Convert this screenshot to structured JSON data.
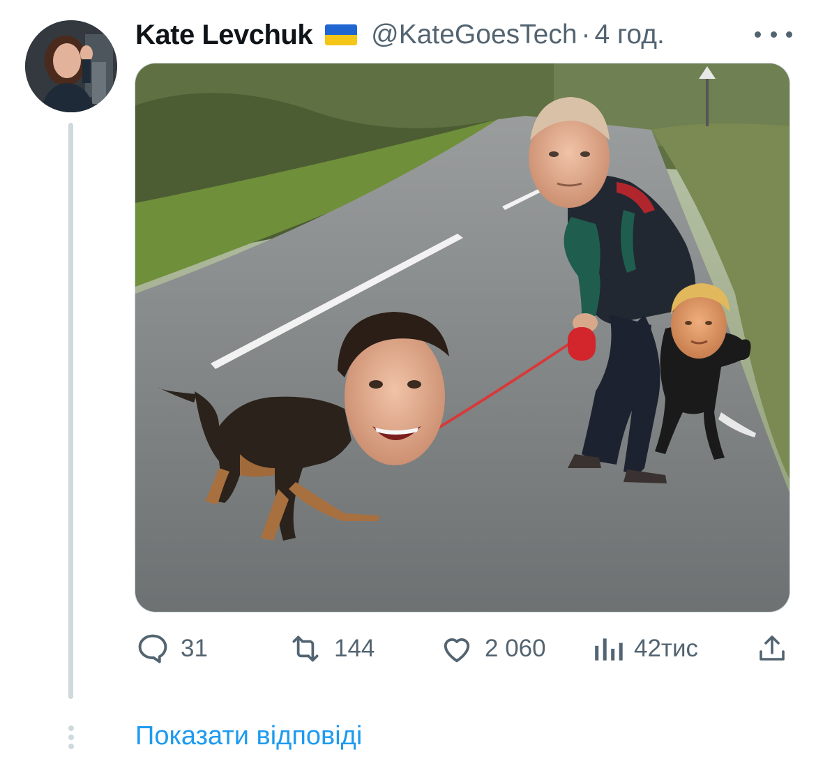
{
  "tweet": {
    "author": {
      "display_name": "Kate Levchuk",
      "flag_icon": "ukraine-flag-icon",
      "handle": "@KateGoesTech",
      "separator": "·",
      "time_ago": "4 год."
    },
    "actions": {
      "replies": "31",
      "retweets": "144",
      "likes": "2 060",
      "views": "42тис"
    },
    "icons": {
      "reply": "comment-icon",
      "retweet": "retweet-icon",
      "like": "heart-icon",
      "views": "views-bar-chart-icon",
      "share": "share-upload-icon",
      "more": "more-dots-icon"
    }
  },
  "thread": {
    "show_replies_label": "Показати відповіді"
  },
  "colors": {
    "text_primary": "#0f1419",
    "text_secondary": "#536471",
    "link": "#1d9bf0",
    "thread_line": "#cfd9de"
  }
}
